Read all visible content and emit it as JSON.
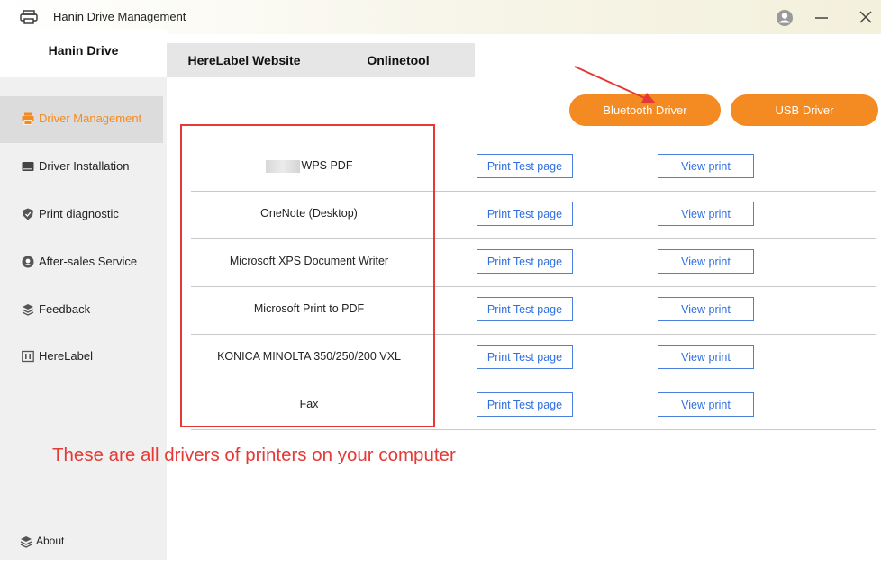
{
  "window": {
    "title": "Hanin Drive Management"
  },
  "tabs": [
    {
      "label": "Hanin Drive"
    },
    {
      "label": "HereLabel Website"
    },
    {
      "label": "Onlinetool"
    }
  ],
  "sidebar": {
    "items": [
      {
        "label": "Driver Management",
        "icon": "printer-icon"
      },
      {
        "label": "Driver Installation",
        "icon": "drive-icon"
      },
      {
        "label": "Print diagnostic",
        "icon": "shield-icon"
      },
      {
        "label": "After-sales Service",
        "icon": "support-icon"
      },
      {
        "label": "Feedback",
        "icon": "layers-icon"
      },
      {
        "label": "HereLabel",
        "icon": "label-icon"
      }
    ],
    "about": {
      "label": "About",
      "icon": "layers-icon"
    }
  },
  "driver_buttons": {
    "bluetooth": "Bluetooth Driver",
    "usb": "USB Driver"
  },
  "printers": [
    {
      "name": "WPS PDF",
      "test": "Print Test page",
      "view": "View print"
    },
    {
      "name": "OneNote (Desktop)",
      "test": "Print Test page",
      "view": "View print"
    },
    {
      "name": "Microsoft XPS Document Writer",
      "test": "Print Test page",
      "view": "View print"
    },
    {
      "name": "Microsoft Print to PDF",
      "test": "Print Test page",
      "view": "View print"
    },
    {
      "name": "KONICA MINOLTA 350/250/200 VXL",
      "test": "Print Test page",
      "view": "View print"
    },
    {
      "name": "Fax",
      "test": "Print Test page",
      "view": "View print"
    }
  ],
  "annotation": {
    "text": "These are all drivers of printers on your computer"
  },
  "colors": {
    "accent": "#f48a22",
    "link_blue": "#2f6fe0",
    "annotation_red": "#e53935"
  }
}
